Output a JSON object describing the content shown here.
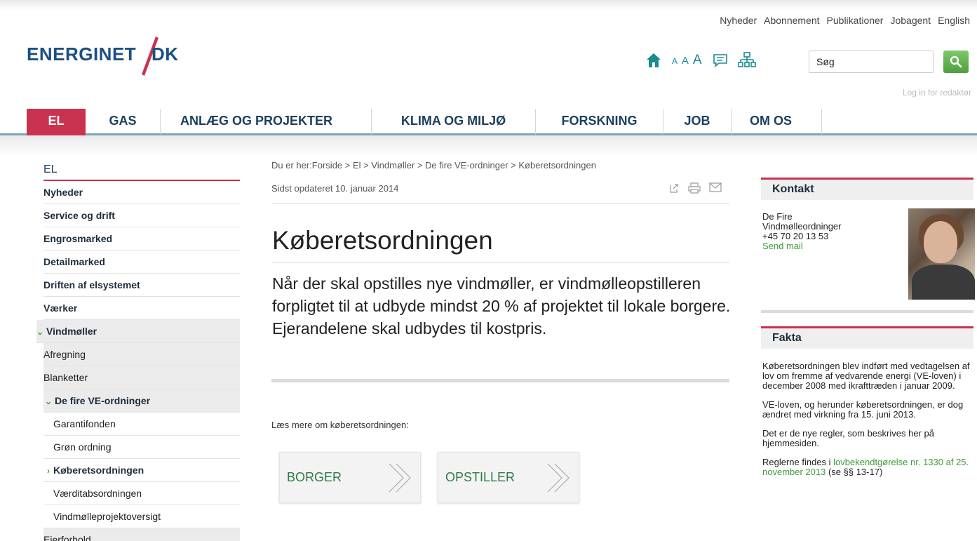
{
  "top_links": [
    "Nyheder",
    "Abonnement",
    "Publikationer",
    "Jobagent",
    "English"
  ],
  "logo": {
    "left": "ENERGINET",
    "right": "DK"
  },
  "tools": {
    "font_sizes": [
      "A",
      "A",
      "A"
    ]
  },
  "search": {
    "value": "Søg"
  },
  "login_link": "Log in for redaktør",
  "main_nav": [
    "EL",
    "GAS",
    "ANLÆG OG PROJEKTER",
    "KLIMA OG MILJØ",
    "FORSKNING",
    "JOB",
    "OM OS"
  ],
  "sidebar": {
    "title": "EL",
    "items": [
      {
        "label": "Nyheder"
      },
      {
        "label": "Service og drift"
      },
      {
        "label": "Engrosmarked"
      },
      {
        "label": "Detailmarked"
      },
      {
        "label": "Driften af elsystemet"
      },
      {
        "label": "Værker"
      },
      {
        "label": "Vindmøller"
      },
      {
        "label": "Afregning"
      },
      {
        "label": "Blanketter"
      },
      {
        "label": "De fire VE-ordninger"
      },
      {
        "label": "Garantifonden"
      },
      {
        "label": "Grøn ordning"
      },
      {
        "label": "Køberetsordningen"
      },
      {
        "label": "Værditabsordningen"
      },
      {
        "label": "Vindmølleprojektoversigt"
      },
      {
        "label": "Ejerforhold"
      }
    ]
  },
  "breadcrumb": "Du er her:Forside > El > Vindmøller > De fire VE-ordninger > Køberetsordningen",
  "updated": "Sidst opdateret 10. januar 2014",
  "title": "Køberetsordningen",
  "lead": "Når der skal opstilles nye vindmøller, er vindmølleopstilleren forpligtet til at udbyde mindst 20 % af projektet til lokale borgere. Ejerandelene skal udbydes til kostpris.",
  "read_more": "Læs mere om køberetsordningen:",
  "cta": [
    "BORGER",
    "OPSTILLER"
  ],
  "contact": {
    "title": "Kontakt",
    "line1": "De Fire",
    "line2": "Vindmølleordninger",
    "phone": "+45 70 20 13 53",
    "mail": "Send mail"
  },
  "fakta": {
    "title": "Fakta",
    "p1": "Køberetsordningen blev indført med vedtagelsen af lov om fremme af vedvarende energi (VE-loven) i december 2008 med ikrafttræden i januar 2009.",
    "p2": "VE-loven, og herunder køberetsordningen, er dog ændret med virkning fra 15. juni 2013.",
    "p3": "Det er de nye regler, som beskrives her på hjemmesiden.",
    "p4_pre": "Reglerne findes i ",
    "p4_link": "lovbekendtgørelse nr. 1330 af 25. november 2013",
    "p4_post": " (se §§ 13-17)"
  },
  "colors": {
    "brand_red": "#c9334f",
    "brand_blue": "#1a4f86",
    "teal": "#1a8a93",
    "green": "#3d9b3a"
  }
}
